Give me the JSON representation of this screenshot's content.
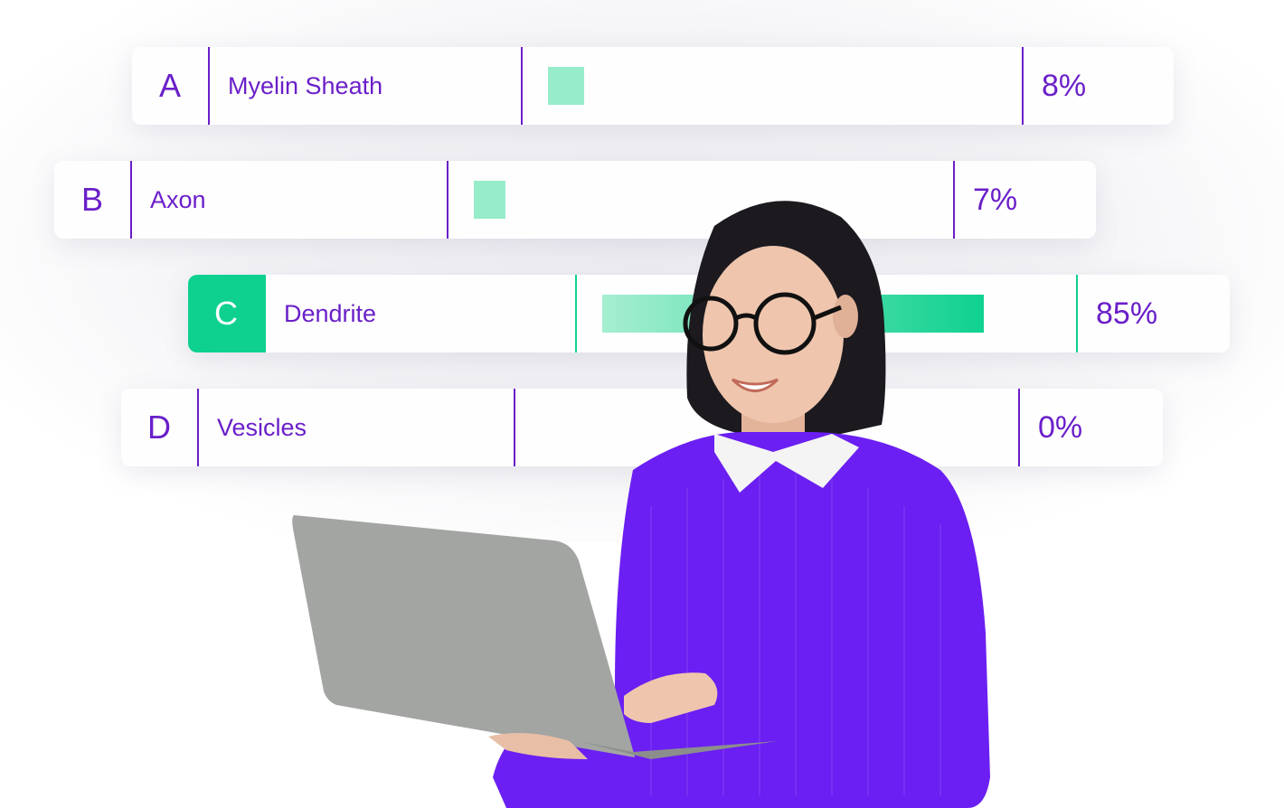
{
  "quiz": {
    "options": [
      {
        "letter": "A",
        "label": "Myelin Sheath",
        "percent_text": "8%",
        "percent": 8,
        "selected": false
      },
      {
        "letter": "B",
        "label": "Axon",
        "percent_text": "7%",
        "percent": 7,
        "selected": false
      },
      {
        "letter": "C",
        "label": "Dendrite",
        "percent_text": "85%",
        "percent": 85,
        "selected": true
      },
      {
        "letter": "D",
        "label": "Vesicles",
        "percent_text": "0%",
        "percent": 0,
        "selected": false
      }
    ]
  },
  "colors": {
    "accent_purple": "#6a1fc9",
    "correct_green": "#0fd18f",
    "bar_light_green": "#97ecca",
    "sweater_purple": "#6b1ff2",
    "laptop_gray": "#a3a5a3"
  },
  "illustration": {
    "subject": "woman-with-glasses-holding-laptop"
  }
}
